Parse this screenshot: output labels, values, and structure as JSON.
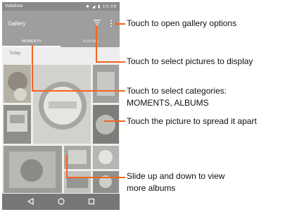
{
  "status_bar": {
    "carrier": "Vodafone",
    "time": "10:09"
  },
  "app_bar": {
    "title": "Gallery",
    "icons": [
      "filter-icon",
      "overflow-menu-icon"
    ]
  },
  "tabs": [
    {
      "label": "MOMENTS",
      "selected": true
    },
    {
      "label": "ALBUMS",
      "selected": false
    }
  ],
  "section": {
    "label": "Today"
  },
  "nav_bar": {
    "icons": [
      "back-icon",
      "home-icon",
      "recents-icon"
    ]
  },
  "callouts": [
    {
      "text": "Touch to open gallery options"
    },
    {
      "text": "Touch to select pictures to display"
    },
    {
      "line1": "Touch  to  select  categories:",
      "line2": "MOMENTS, ALBUMS"
    },
    {
      "text": "Touch the picture to spread it apart"
    },
    {
      "line1": "Slide up and down to view",
      "line2": "more albums"
    }
  ],
  "colors": {
    "annotation": "#f26522",
    "app_bar": "#9e9e9e",
    "status_bar": "#8a8a8a"
  }
}
